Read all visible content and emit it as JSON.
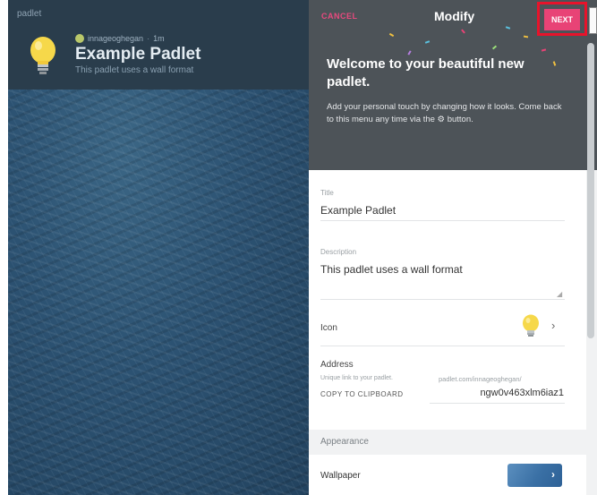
{
  "board": {
    "logo": "padlet",
    "author": "innageoghegan",
    "time": "1m",
    "title": "Example Padlet",
    "subtitle": "This padlet uses a wall format"
  },
  "modify_panel": {
    "cancel_label": "CANCEL",
    "title": "Modify",
    "next_label": "NEXT",
    "welcome_title": "Welcome to your beautiful new padlet.",
    "welcome_text": "Add your personal touch by changing how it looks. Come back to this menu any time via the ⚙ button.",
    "title_field": {
      "label": "Title",
      "value": "Example Padlet"
    },
    "description_field": {
      "label": "Description",
      "value": "This padlet uses a wall format"
    },
    "icon_row": {
      "label": "Icon",
      "icon": "lightbulb-icon"
    },
    "address": {
      "label": "Address",
      "hint": "Unique link to your padlet.",
      "url_prefix": "padlet.com/innageoghegan/",
      "copy_label": "COPY TO CLIPBOARD",
      "slug": "ngw0v463xlm6iaz1"
    },
    "appearance_label": "Appearance",
    "wallpaper_label": "Wallpaper"
  },
  "colors": {
    "accent": "#e84376",
    "highlight": "#e8132b",
    "header_bg": "#4d5358",
    "board_bg": "#2c5272"
  }
}
